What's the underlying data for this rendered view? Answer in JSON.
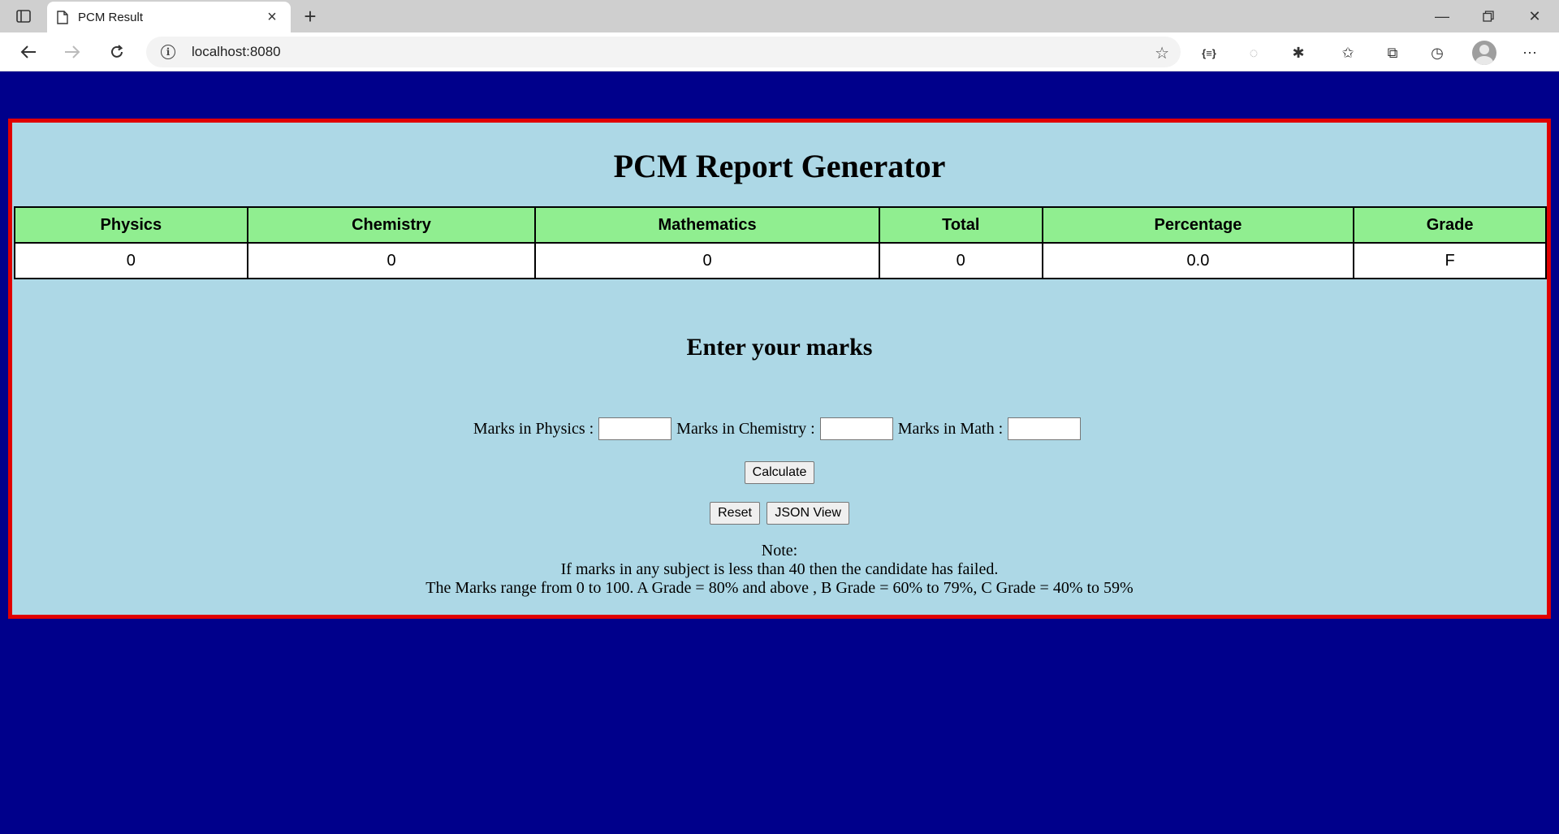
{
  "browser": {
    "tab_title": "PCM Result",
    "url": "localhost:8080"
  },
  "page": {
    "title": "PCM Report Generator",
    "table": {
      "headers": [
        "Physics",
        "Chemistry",
        "Mathematics",
        "Total",
        "Percentage",
        "Grade"
      ],
      "row": [
        "0",
        "0",
        "0",
        "0",
        "0.0",
        "F"
      ]
    },
    "form": {
      "heading": "Enter your marks",
      "physics_label": "Marks in Physics :",
      "physics_value": "",
      "chemistry_label": "Marks in Chemistry :",
      "chemistry_value": "",
      "math_label": "Marks in Math :",
      "math_value": "",
      "calculate_label": "Calculate",
      "reset_label": "Reset",
      "json_view_label": "JSON View"
    },
    "note": {
      "title": "Note:",
      "line1": "If marks in any subject is less than 40 then the candidate has failed.",
      "line2": "The Marks range from 0 to 100. A Grade = 80% and above , B Grade = 60% to 79%, C Grade = 40% to 59%"
    }
  },
  "colors": {
    "background": "#00008b",
    "panel": "#add8e6",
    "panel_border": "#e00000",
    "header_cells": "#90ee90"
  }
}
